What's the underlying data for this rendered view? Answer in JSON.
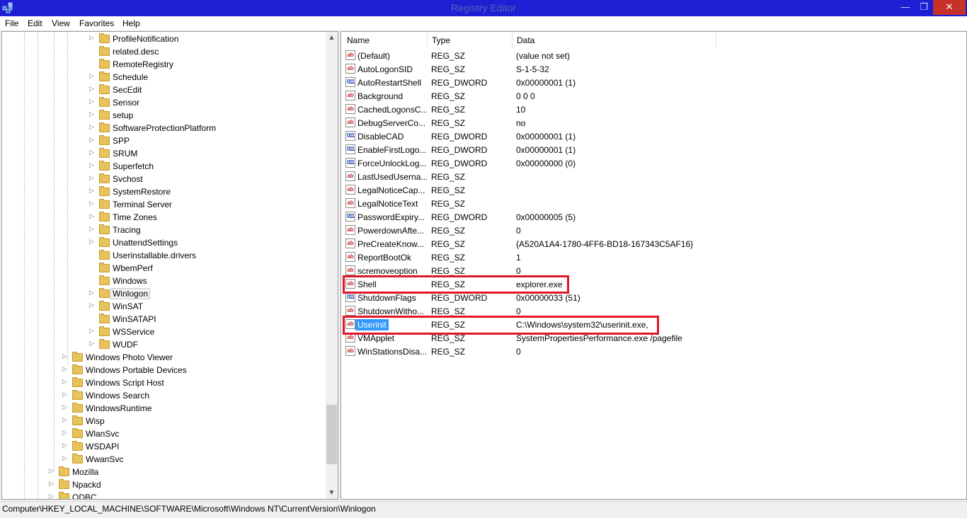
{
  "window": {
    "title": "Registry Editor"
  },
  "menu": [
    "File",
    "Edit",
    "View",
    "Favorites",
    "Help"
  ],
  "tree": {
    "items": [
      {
        "label": "ProfileNotification",
        "has_children": true
      },
      {
        "label": "related.desc",
        "has_children": false
      },
      {
        "label": "RemoteRegistry",
        "has_children": false
      },
      {
        "label": "Schedule",
        "has_children": true
      },
      {
        "label": "SecEdit",
        "has_children": true
      },
      {
        "label": "Sensor",
        "has_children": true
      },
      {
        "label": "setup",
        "has_children": true
      },
      {
        "label": "SoftwareProtectionPlatform",
        "has_children": true
      },
      {
        "label": "SPP",
        "has_children": true
      },
      {
        "label": "SRUM",
        "has_children": true
      },
      {
        "label": "Superfetch",
        "has_children": true
      },
      {
        "label": "Svchost",
        "has_children": true
      },
      {
        "label": "SystemRestore",
        "has_children": true
      },
      {
        "label": "Terminal Server",
        "has_children": true
      },
      {
        "label": "Time Zones",
        "has_children": true
      },
      {
        "label": "Tracing",
        "has_children": true
      },
      {
        "label": "UnattendSettings",
        "has_children": true
      },
      {
        "label": "Userinstallable.drivers",
        "has_children": false
      },
      {
        "label": "WbemPerf",
        "has_children": false
      },
      {
        "label": "Windows",
        "has_children": false
      },
      {
        "label": "Winlogon",
        "has_children": true,
        "selected": true
      },
      {
        "label": "WinSAT",
        "has_children": true
      },
      {
        "label": "WinSATAPI",
        "has_children": false
      },
      {
        "label": "WSService",
        "has_children": true
      },
      {
        "label": "WUDF",
        "has_children": true
      },
      {
        "label": "Windows Photo Viewer",
        "has_children": true
      },
      {
        "label": "Windows Portable Devices",
        "has_children": true
      },
      {
        "label": "Windows Script Host",
        "has_children": true
      },
      {
        "label": "Windows Search",
        "has_children": true
      },
      {
        "label": "WindowsRuntime",
        "has_children": true
      },
      {
        "label": "Wisp",
        "has_children": true
      },
      {
        "label": "WlanSvc",
        "has_children": true
      },
      {
        "label": "WSDAPI",
        "has_children": true
      },
      {
        "label": "WwanSvc",
        "has_children": true
      },
      {
        "label": "Mozilla",
        "has_children": true
      },
      {
        "label": "Npackd",
        "has_children": true
      },
      {
        "label": "ODBC",
        "has_children": true
      }
    ]
  },
  "columns": {
    "name": "Name",
    "type": "Type",
    "data": "Data"
  },
  "values": [
    {
      "icon": "ab",
      "name": "(Default)",
      "type": "REG_SZ",
      "data": "(value not set)"
    },
    {
      "icon": "ab",
      "name": "AutoLogonSID",
      "type": "REG_SZ",
      "data": "S-1-5-32"
    },
    {
      "icon": "bin",
      "name": "AutoRestartShell",
      "type": "REG_DWORD",
      "data": "0x00000001 (1)"
    },
    {
      "icon": "ab",
      "name": "Background",
      "type": "REG_SZ",
      "data": "0 0 0"
    },
    {
      "icon": "ab",
      "name": "CachedLogonsC...",
      "type": "REG_SZ",
      "data": "10"
    },
    {
      "icon": "ab",
      "name": "DebugServerCo...",
      "type": "REG_SZ",
      "data": "no"
    },
    {
      "icon": "bin",
      "name": "DisableCAD",
      "type": "REG_DWORD",
      "data": "0x00000001 (1)"
    },
    {
      "icon": "bin",
      "name": "EnableFirstLogo...",
      "type": "REG_DWORD",
      "data": "0x00000001 (1)"
    },
    {
      "icon": "bin",
      "name": "ForceUnlockLog...",
      "type": "REG_DWORD",
      "data": "0x00000000 (0)"
    },
    {
      "icon": "ab",
      "name": "LastUsedUserna...",
      "type": "REG_SZ",
      "data": ""
    },
    {
      "icon": "ab",
      "name": "LegalNoticeCap...",
      "type": "REG_SZ",
      "data": ""
    },
    {
      "icon": "ab",
      "name": "LegalNoticeText",
      "type": "REG_SZ",
      "data": ""
    },
    {
      "icon": "bin",
      "name": "PasswordExpiry...",
      "type": "REG_DWORD",
      "data": "0x00000005 (5)"
    },
    {
      "icon": "ab",
      "name": "PowerdownAfte...",
      "type": "REG_SZ",
      "data": "0"
    },
    {
      "icon": "ab",
      "name": "PreCreateKnow...",
      "type": "REG_SZ",
      "data": "{A520A1A4-1780-4FF6-BD18-167343C5AF16}"
    },
    {
      "icon": "ab",
      "name": "ReportBootOk",
      "type": "REG_SZ",
      "data": "1"
    },
    {
      "icon": "ab",
      "name": "scremoveoption",
      "type": "REG_SZ",
      "data": "0"
    },
    {
      "icon": "ab",
      "name": "Shell",
      "type": "REG_SZ",
      "data": "explorer.exe",
      "highlighted": true
    },
    {
      "icon": "bin",
      "name": "ShutdownFlags",
      "type": "REG_DWORD",
      "data": "0x00000033 (51)"
    },
    {
      "icon": "ab",
      "name": "ShutdownWitho...",
      "type": "REG_SZ",
      "data": "0"
    },
    {
      "icon": "ab",
      "name": "Userinit",
      "type": "REG_SZ",
      "data": "C:\\Windows\\system32\\userinit.exe,",
      "selected": true,
      "highlighted": true
    },
    {
      "icon": "ab",
      "name": "VMApplet",
      "type": "REG_SZ",
      "data": "SystemPropertiesPerformance.exe /pagefile"
    },
    {
      "icon": "ab",
      "name": "WinStationsDisa...",
      "type": "REG_SZ",
      "data": "0"
    }
  ],
  "status": {
    "path": "Computer\\HKEY_LOCAL_MACHINE\\SOFTWARE\\Microsoft\\Windows NT\\CurrentVersion\\Winlogon"
  },
  "colors": {
    "titlebar": "#1e1ed4",
    "close": "#c7312a",
    "highlight_box": "#e0162b",
    "selection": "#3399ff"
  }
}
